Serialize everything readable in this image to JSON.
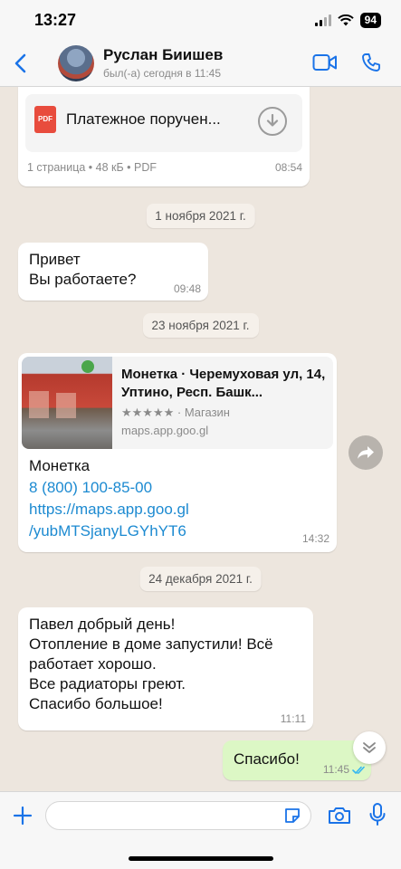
{
  "status": {
    "time": "13:27",
    "battery": "94"
  },
  "header": {
    "name": "Руслан Биишев",
    "last_seen": "был(-а) сегодня в 11:45"
  },
  "pdf": {
    "badge": "PDF",
    "filename": "Платежное поручен...",
    "meta": "1 страница • 48 кБ • PDF",
    "time": "08:54"
  },
  "date1": "1 ноября 2021 г.",
  "msg1": {
    "text": "Привет\nВы работаете?",
    "time": "09:48"
  },
  "date2": "23 ноября 2021 г.",
  "location": {
    "title": "Монетка · Черемуховая ул, 14, Уптино, Респ. Башк...",
    "rating": "★★★★★ · Магазин",
    "domain": "maps.app.goo.gl",
    "name": "Монетка",
    "phone": "8 (800) 100-85-00",
    "url_line1": "https://maps.app.goo.gl",
    "url_line2": "/yubMTSjanyLGYhYT6",
    "time": "14:32"
  },
  "date3": "24 декабря 2021 г.",
  "msg2": {
    "text": "Павел добрый день!\nОтопление в доме запустили! Всё работает хорошо.\nВсе радиаторы греют.\nСпасибо большое!",
    "time": "11:11"
  },
  "msg3": {
    "text": "Спасибо!",
    "time": "11:45"
  }
}
